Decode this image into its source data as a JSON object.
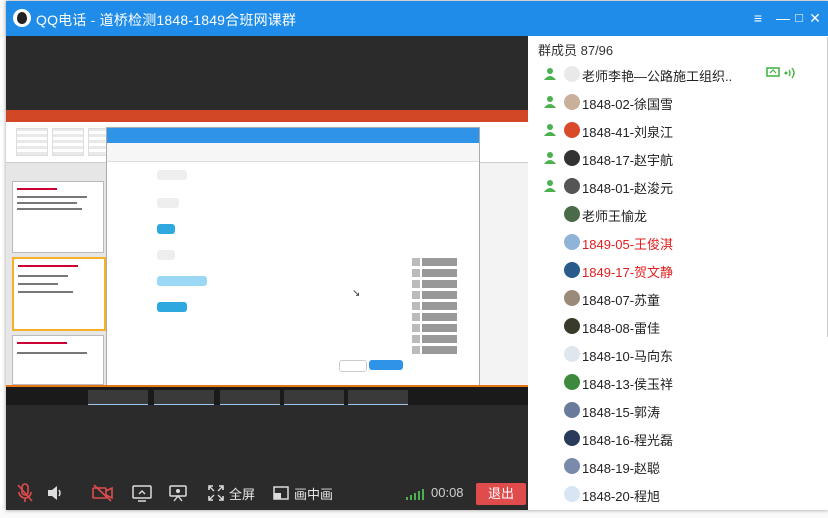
{
  "window": {
    "title": "QQ电话 - 道桥检测1848-1849合班网课群"
  },
  "window_controls": {
    "menu": "≡",
    "minimize": "—",
    "maximize": "□",
    "close": "✕"
  },
  "controls": {
    "fullscreen_label": "全屏",
    "pip_label": "画中画",
    "timer": "00:08",
    "exit_label": "退出"
  },
  "panel": {
    "count_label": "群成员 87/96",
    "members": [
      {
        "name": "老师李艳—公路施工组织...",
        "mic": true,
        "red": false,
        "avatar_color": "#e9e9e9"
      },
      {
        "name": "1848-02-徐国雪",
        "mic": true,
        "red": false,
        "avatar_color": "#c8b09a"
      },
      {
        "name": "1848-41-刘泉江",
        "mic": true,
        "red": false,
        "avatar_color": "#d94a2b"
      },
      {
        "name": "1848-17-赵宇航",
        "mic": true,
        "red": false,
        "avatar_color": "#333333"
      },
      {
        "name": "1848-01-赵浚元",
        "mic": true,
        "red": false,
        "avatar_color": "#555555"
      },
      {
        "name": "老师王愉龙",
        "mic": false,
        "red": false,
        "avatar_color": "#4a6b4a"
      },
      {
        "name": "1849-05-王俊淇",
        "mic": false,
        "red": true,
        "avatar_color": "#8fb4d8"
      },
      {
        "name": "1849-17-贺文静",
        "mic": false,
        "red": true,
        "avatar_color": "#2a5a8a"
      },
      {
        "name": "1848-07-苏童",
        "mic": false,
        "red": false,
        "avatar_color": "#9a8a7a"
      },
      {
        "name": "1848-08-雷佳",
        "mic": false,
        "red": false,
        "avatar_color": "#3a3a2a"
      },
      {
        "name": "1848-10-马向东",
        "mic": false,
        "red": false,
        "avatar_color": "#dfe6ee"
      },
      {
        "name": "1848-13-侯玉祥",
        "mic": false,
        "red": false,
        "avatar_color": "#3d8a3d"
      },
      {
        "name": "1848-15-郭涛",
        "mic": false,
        "red": false,
        "avatar_color": "#6a7a9a"
      },
      {
        "name": "1848-16-程光磊",
        "mic": false,
        "red": false,
        "avatar_color": "#2a3a5a"
      },
      {
        "name": "1848-19-赵聪",
        "mic": false,
        "red": false,
        "avatar_color": "#7a8aaa"
      },
      {
        "name": "1848-20-程旭",
        "mic": false,
        "red": false,
        "avatar_color": "#d8e6f4"
      }
    ]
  },
  "colors": {
    "titlebar": "#1e8ce8",
    "exit": "#e04c4c",
    "speaking": "#4caf50",
    "red_name": "#e0201f"
  }
}
